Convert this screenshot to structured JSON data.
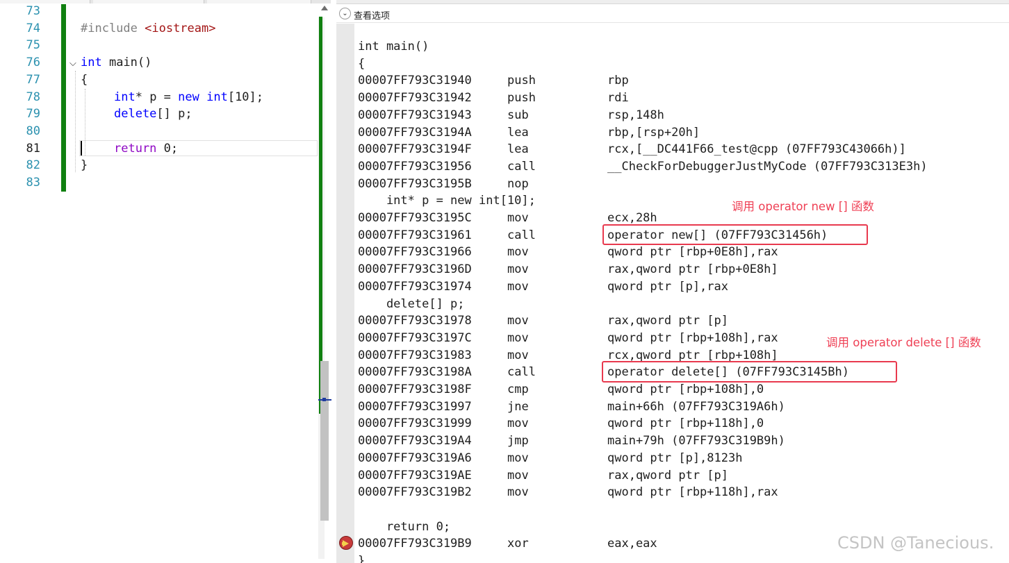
{
  "editor": {
    "lines": [
      {
        "no": "73"
      },
      {
        "no": "74",
        "text_pp": "#include ",
        "text_str": "<iostream>"
      },
      {
        "no": "75"
      },
      {
        "no": "76",
        "kw": "int",
        "rest": " main()"
      },
      {
        "no": "77",
        "rest": "{"
      },
      {
        "no": "78",
        "kw1": "int",
        "mid1": "* p = ",
        "kw2": "new",
        "sp": " ",
        "kw3": "int",
        "rest": "[10];"
      },
      {
        "no": "79",
        "kw": "delete",
        "rest": "[] p;"
      },
      {
        "no": "80"
      },
      {
        "no": "81",
        "kw": "return",
        "rest": " 0;"
      },
      {
        "no": "82",
        "rest": "}"
      },
      {
        "no": "83"
      }
    ]
  },
  "disassembly": {
    "view_options_label": "查看选项",
    "header_lines": [
      "int main()",
      "{"
    ],
    "rows": [
      {
        "addr": "00007FF793C31940",
        "op": "push",
        "arg": "rbp"
      },
      {
        "addr": "00007FF793C31942",
        "op": "push",
        "arg": "rdi"
      },
      {
        "addr": "00007FF793C31943",
        "op": "sub",
        "arg": "rsp,148h"
      },
      {
        "addr": "00007FF793C3194A",
        "op": "lea",
        "arg": "rbp,[rsp+20h]"
      },
      {
        "addr": "00007FF793C3194F",
        "op": "lea",
        "arg": "rcx,[__DC441F66_test@cpp (07FF793C43066h)]"
      },
      {
        "addr": "00007FF793C31956",
        "op": "call",
        "arg": "__CheckForDebuggerJustMyCode (07FF793C313E3h)"
      },
      {
        "addr": "00007FF793C3195B",
        "op": "nop",
        "arg": ""
      },
      {
        "src": "    int* p = new int[10];"
      },
      {
        "addr": "00007FF793C3195C",
        "op": "mov",
        "arg": "ecx,28h"
      },
      {
        "addr": "00007FF793C31961",
        "op": "call",
        "arg": "operator new[] (07FF793C31456h)"
      },
      {
        "addr": "00007FF793C31966",
        "op": "mov",
        "arg": "qword ptr [rbp+0E8h],rax"
      },
      {
        "addr": "00007FF793C3196D",
        "op": "mov",
        "arg": "rax,qword ptr [rbp+0E8h]"
      },
      {
        "addr": "00007FF793C31974",
        "op": "mov",
        "arg": "qword ptr [p],rax"
      },
      {
        "src": "    delete[] p;"
      },
      {
        "addr": "00007FF793C31978",
        "op": "mov",
        "arg": "rax,qword ptr [p]"
      },
      {
        "addr": "00007FF793C3197C",
        "op": "mov",
        "arg": "qword ptr [rbp+108h],rax"
      },
      {
        "addr": "00007FF793C31983",
        "op": "mov",
        "arg": "rcx,qword ptr [rbp+108h]"
      },
      {
        "addr": "00007FF793C3198A",
        "op": "call",
        "arg": "operator delete[] (07FF793C3145Bh)"
      },
      {
        "addr": "00007FF793C3198F",
        "op": "cmp",
        "arg": "qword ptr [rbp+108h],0"
      },
      {
        "addr": "00007FF793C31997",
        "op": "jne",
        "arg": "main+66h (07FF793C319A6h)"
      },
      {
        "addr": "00007FF793C31999",
        "op": "mov",
        "arg": "qword ptr [rbp+118h],0"
      },
      {
        "addr": "00007FF793C319A4",
        "op": "jmp",
        "arg": "main+79h (07FF793C319B9h)"
      },
      {
        "addr": "00007FF793C319A6",
        "op": "mov",
        "arg": "qword ptr [p],8123h"
      },
      {
        "addr": "00007FF793C319AE",
        "op": "mov",
        "arg": "rax,qword ptr [p]"
      },
      {
        "addr": "00007FF793C319B2",
        "op": "mov",
        "arg": "qword ptr [rbp+118h],rax"
      },
      {
        "src": ""
      },
      {
        "src": "    return 0;"
      },
      {
        "addr": "00007FF793C319B9",
        "op": "xor",
        "arg": "eax,eax"
      },
      {
        "src": "}"
      }
    ],
    "annotations": {
      "new_note": "调用 operator new [] 函数",
      "delete_note": "调用 operator delete [] 函数"
    }
  },
  "watermark": "CSDN @Tanecious.",
  "colors": {
    "annotation": "#ef4055",
    "keyword": "#0000ff",
    "change_bar": "#108010"
  }
}
